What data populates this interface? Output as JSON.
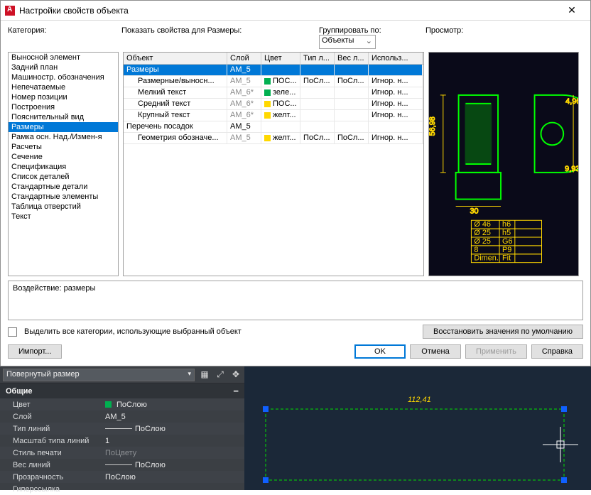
{
  "window": {
    "title": "Настройки свойств объекта"
  },
  "labels": {
    "category": "Категория:",
    "show_props": "Показать свойства для Размеры:",
    "group_by": "Группировать по:",
    "preview": "Просмотр:"
  },
  "group_select": "Объекты",
  "categories": [
    "Выносной элемент",
    "Задний план",
    "Машиностр. обозначения",
    "Непечатаемые",
    "Номер позиции",
    "Построения",
    "Пояснительный вид",
    "Размеры",
    "Рамка осн. Над./Измен-я",
    "Расчеты",
    "Сечение",
    "Спецификация",
    "Список деталей",
    "Стандартные детали",
    "Стандартные элементы",
    "Таблица отверстий",
    "Текст"
  ],
  "selected_category_index": 7,
  "table": {
    "headers": [
      "Объект",
      "Слой",
      "Цвет",
      "Тип л...",
      "Вес л...",
      "Использ..."
    ],
    "rows": [
      {
        "obj": "Размеры",
        "layer": "AM_5",
        "color": "",
        "color_sw": "",
        "lt": "",
        "lw": "",
        "use": "",
        "sel": true,
        "indent": 0
      },
      {
        "obj": "Размерные/выносн...",
        "layer": "AM_5",
        "color": "ПОС...",
        "color_sw": "#00b050",
        "lt": "ПоСл...",
        "lw": "ПоСл...",
        "use": "Игнор. н...",
        "indent": 1,
        "gray_layer": true
      },
      {
        "obj": "Мелкий текст",
        "layer": "AM_6*",
        "color": "зеле...",
        "color_sw": "#00b050",
        "lt": "",
        "lw": "",
        "use": "Игнор. н...",
        "indent": 1,
        "gray_layer": true
      },
      {
        "obj": "Средний текст",
        "layer": "AM_6*",
        "color": "ПОС...",
        "color_sw": "#ffd800",
        "lt": "",
        "lw": "",
        "use": "Игнор. н...",
        "indent": 1,
        "gray_layer": true
      },
      {
        "obj": "Крупный текст",
        "layer": "AM_6*",
        "color": "желт...",
        "color_sw": "#ffd800",
        "lt": "",
        "lw": "",
        "use": "Игнор. н...",
        "indent": 1,
        "gray_layer": true
      },
      {
        "obj": "Перечень посадок",
        "layer": "AM_5",
        "color": "",
        "color_sw": "",
        "lt": "",
        "lw": "",
        "use": "",
        "indent": 0
      },
      {
        "obj": "Геометрия обозначе...",
        "layer": "AM_5",
        "color": "желт...",
        "color_sw": "#ffd800",
        "lt": "ПоСл...",
        "lw": "ПоСл...",
        "use": "Игнор. н...",
        "indent": 1,
        "gray_layer": true
      }
    ]
  },
  "effect_label": "Воздействие: размеры",
  "highlight_all": "Выделить все категории, использующие выбранный объект",
  "buttons": {
    "restore": "Восстановить значения по умолчанию",
    "import": "Импорт...",
    "ok": "OK",
    "cancel": "Отмена",
    "apply": "Применить",
    "help": "Справка"
  },
  "prop_panel": {
    "dropdown": "Повернутый размер",
    "section": "Общие",
    "rows": [
      {
        "k": "Цвет",
        "v": "ПоСлою",
        "sw": "#00b050"
      },
      {
        "k": "Слой",
        "v": "AM_5"
      },
      {
        "k": "Тип линий",
        "v": "ПоСлою",
        "line": true
      },
      {
        "k": "Масштаб типа линий",
        "v": "1"
      },
      {
        "k": "Стиль печати",
        "v": "ПоЦвету",
        "muted": true
      },
      {
        "k": "Вес линий",
        "v": "ПоСлою",
        "line": true
      },
      {
        "k": "Прозрачность",
        "v": "ПоСлою"
      },
      {
        "k": "Гиперссылка",
        "v": ""
      }
    ]
  },
  "viewport": {
    "dim_text": "112,41"
  },
  "preview_table": [
    [
      "Ø 46",
      "h6",
      ""
    ],
    [
      "Ø 25",
      "h5",
      ""
    ],
    [
      "Ø 25",
      "G6",
      ""
    ],
    [
      "8",
      "P9",
      ""
    ],
    [
      "Dimen.",
      "Fit",
      ""
    ]
  ]
}
